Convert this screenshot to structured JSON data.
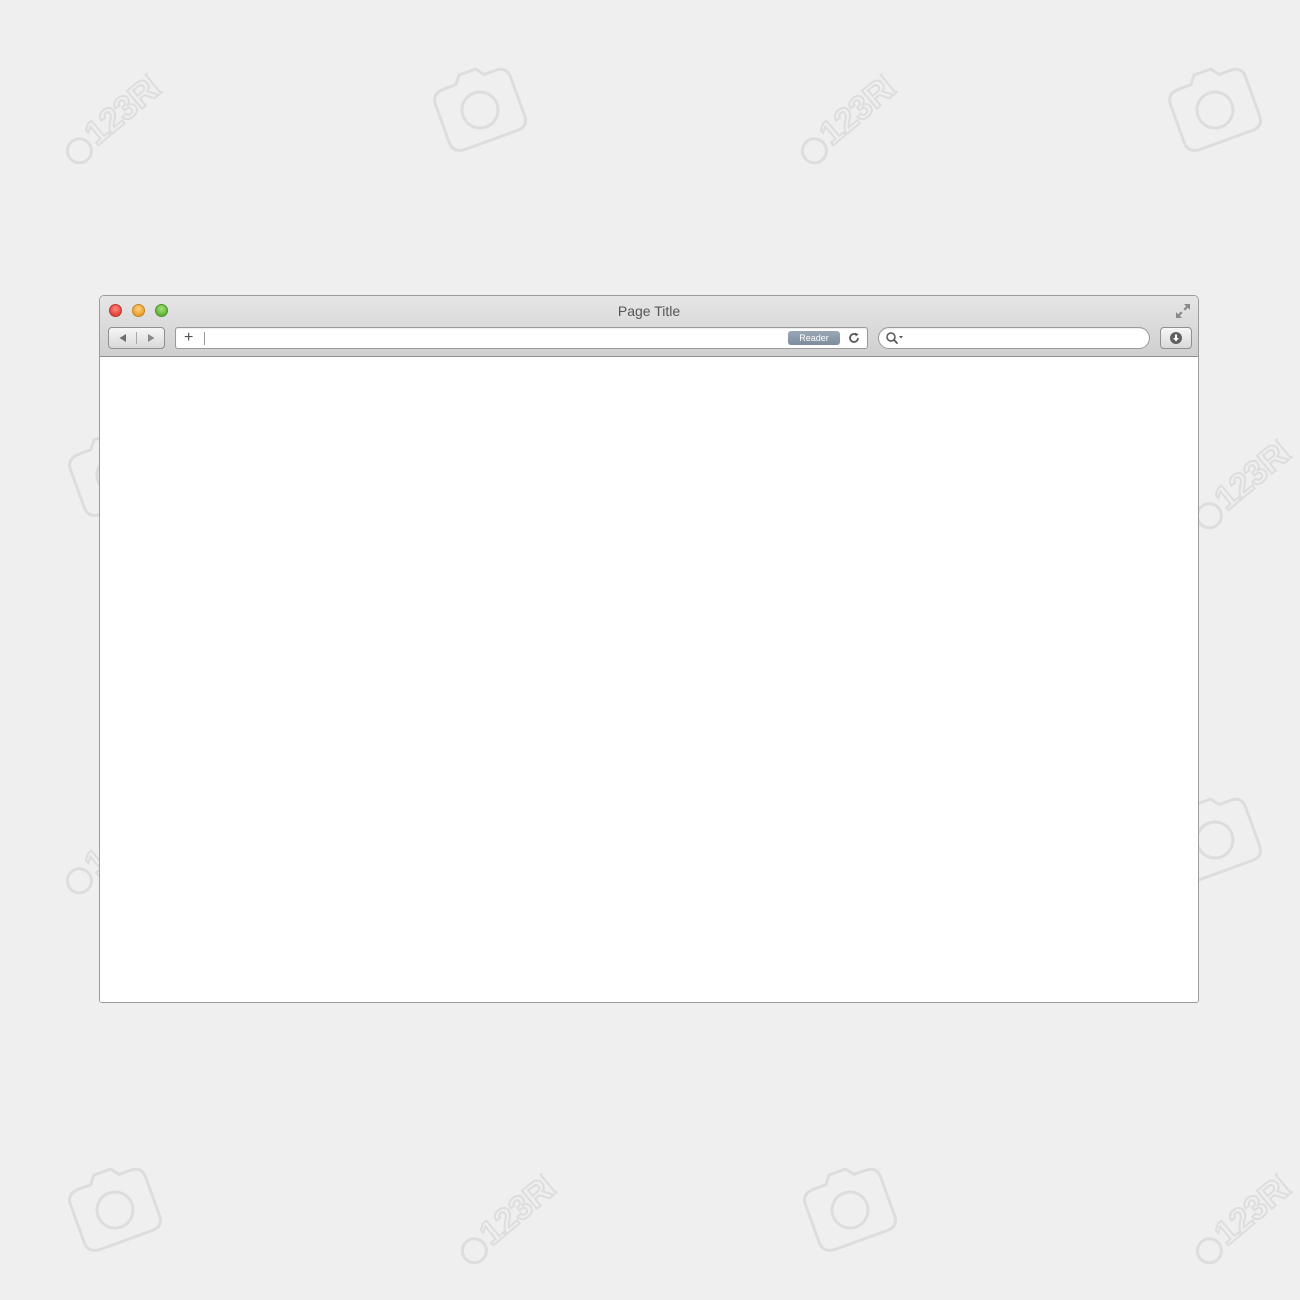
{
  "window": {
    "title": "Page Title"
  },
  "toolbar": {
    "back_icon": "triangle-left-icon",
    "forward_icon": "triangle-right-icon",
    "url_add_icon": "plus-icon",
    "url_value": "",
    "reader_label": "Reader",
    "reload_icon": "reload-icon",
    "search_icon": "magnifier-dropdown-icon",
    "search_value": "",
    "download_icon": "download-icon",
    "fullscreen_icon": "fullscreen-arrows-icon"
  },
  "colors": {
    "close": "#e0443a",
    "minimize": "#e8a130",
    "maximize": "#5fb337",
    "reader_badge": "#8796a6",
    "background": "#efefef"
  },
  "watermark": {
    "text": "123RF",
    "icon": "camera-icon"
  }
}
